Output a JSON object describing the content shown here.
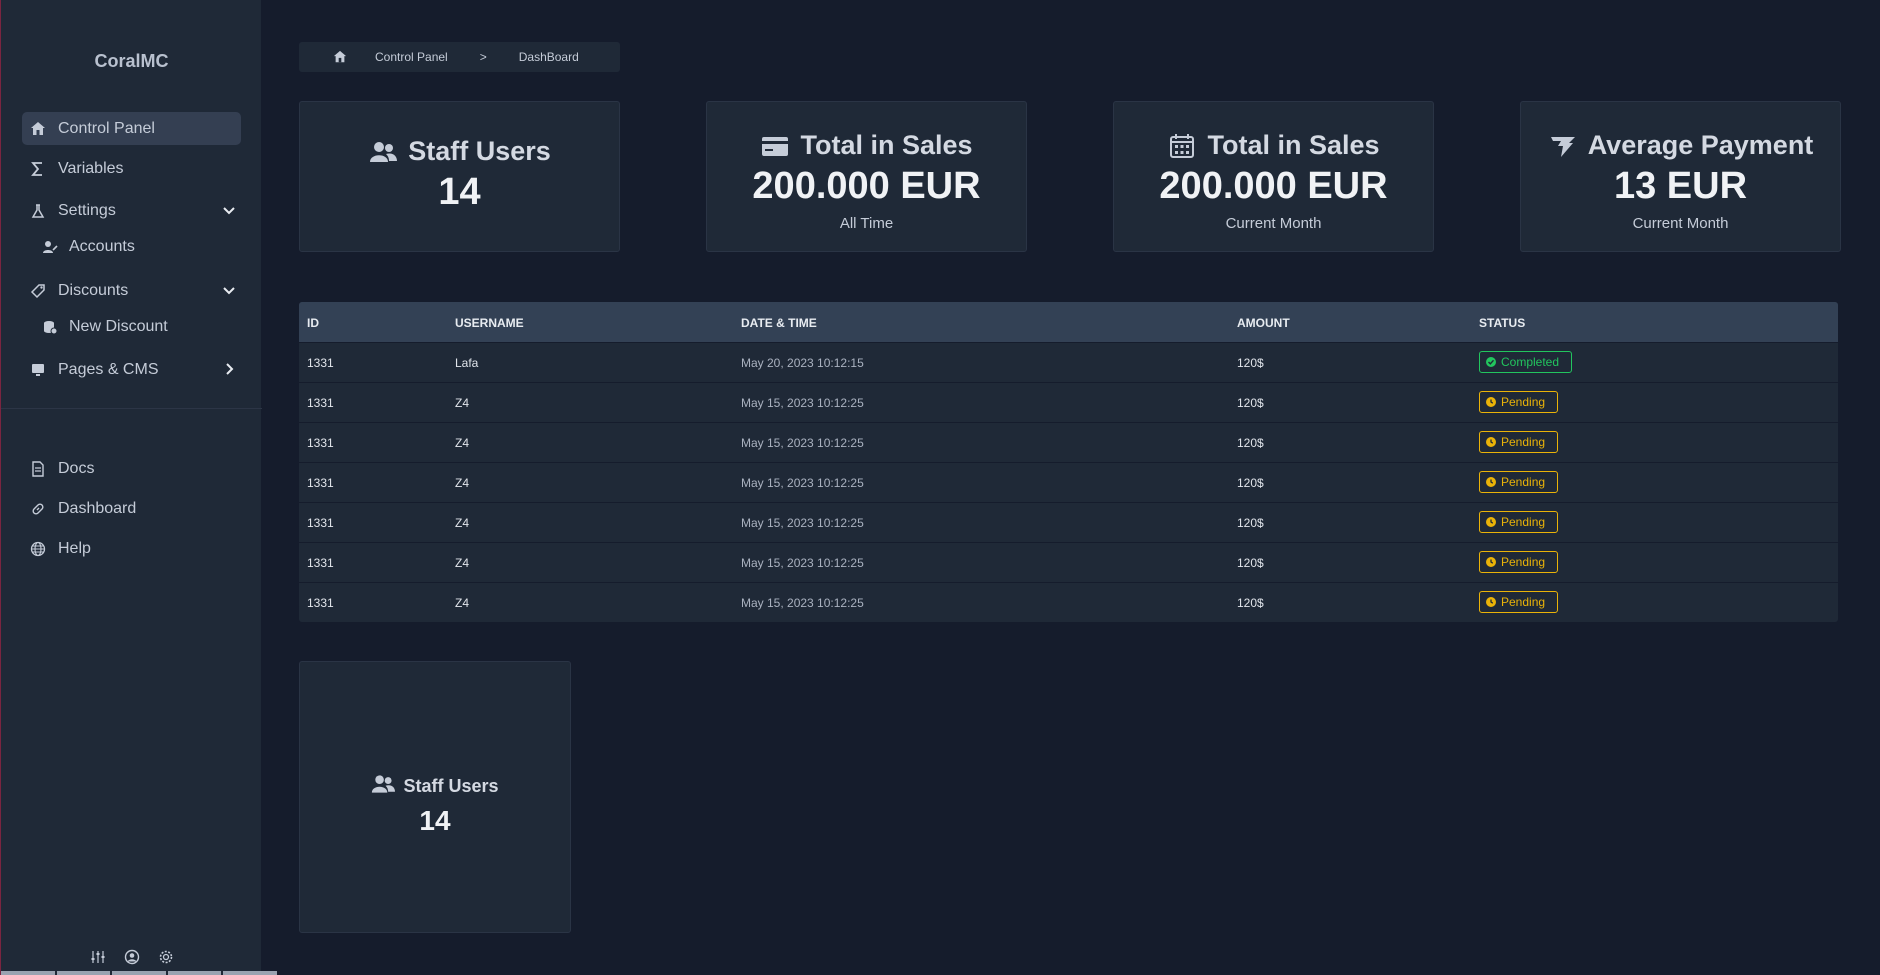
{
  "brand": "CoralMC",
  "sidebar": {
    "items": [
      {
        "label": "Control Panel",
        "icon": "home-icon",
        "active": true
      },
      {
        "label": "Variables",
        "icon": "sigma-icon"
      },
      {
        "label": "Settings",
        "icon": "flask-icon",
        "expandable": "down"
      },
      {
        "label": "Accounts",
        "icon": "user-edit-icon",
        "sub": true
      },
      {
        "label": "Discounts",
        "icon": "tag-icon",
        "expandable": "down"
      },
      {
        "label": "New Discount",
        "icon": "coins-icon",
        "sub": true
      },
      {
        "label": "Pages & CMS",
        "icon": "monitor-icon",
        "expandable": "right"
      },
      {
        "label": "Docs",
        "icon": "document-icon"
      },
      {
        "label": "Dashboard",
        "icon": "link-icon"
      },
      {
        "label": "Help",
        "icon": "globe-icon"
      }
    ],
    "footer_icons": [
      "sliders-icon",
      "user-circle-icon",
      "gear-icon"
    ]
  },
  "breadcrumb": {
    "items": [
      "Control Panel",
      "DashBoard"
    ],
    "separator": ">"
  },
  "cards": [
    {
      "title": "Staff Users",
      "value": "14",
      "sub": "",
      "icon": "users-icon"
    },
    {
      "title": "Total in Sales",
      "value": "200.000 EUR",
      "sub": "All Time",
      "icon": "credit-card-icon"
    },
    {
      "title": "Total in Sales",
      "value": "200.000 EUR",
      "sub": "Current Month",
      "icon": "calendar-icon"
    },
    {
      "title": "Average Payment",
      "value": "13 EUR",
      "sub": "Current Month",
      "icon": "flag-icon"
    }
  ],
  "table": {
    "columns": [
      "ID",
      "USERNAME",
      "DATE & TIME",
      "AMOUNT",
      "STATUS"
    ],
    "rows": [
      {
        "id": "1331",
        "username": "Lafa",
        "datetime": "May 20, 2023 10:12:15",
        "amount": "120$",
        "status": "Completed"
      },
      {
        "id": "1331",
        "username": "Z4",
        "datetime": "May 15, 2023 10:12:25",
        "amount": "120$",
        "status": "Pending"
      },
      {
        "id": "1331",
        "username": "Z4",
        "datetime": "May 15, 2023 10:12:25",
        "amount": "120$",
        "status": "Pending"
      },
      {
        "id": "1331",
        "username": "Z4",
        "datetime": "May 15, 2023 10:12:25",
        "amount": "120$",
        "status": "Pending"
      },
      {
        "id": "1331",
        "username": "Z4",
        "datetime": "May 15, 2023 10:12:25",
        "amount": "120$",
        "status": "Pending"
      },
      {
        "id": "1331",
        "username": "Z4",
        "datetime": "May 15, 2023 10:12:25",
        "amount": "120$",
        "status": "Pending"
      },
      {
        "id": "1331",
        "username": "Z4",
        "datetime": "May 15, 2023 10:12:25",
        "amount": "120$",
        "status": "Pending"
      }
    ]
  },
  "small_card": {
    "title": "Staff Users",
    "value": "14",
    "icon": "users-icon"
  },
  "colors": {
    "background": "#151c2c",
    "panel": "#1f2937",
    "table_header": "#334155",
    "completed": "#22c55e",
    "pending": "#eab308"
  }
}
